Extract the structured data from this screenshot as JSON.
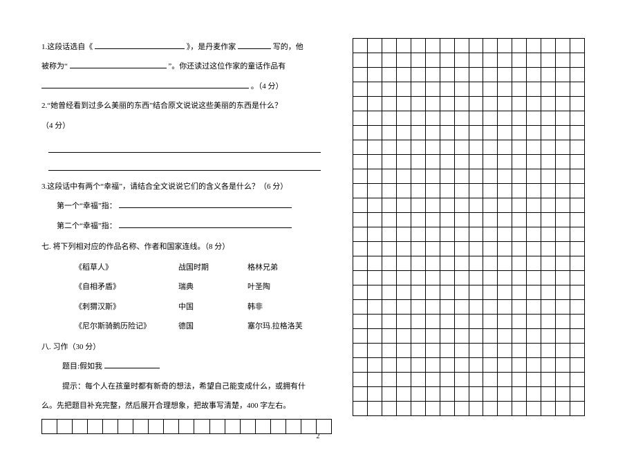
{
  "q1": {
    "prefix": "1.这段话选自《",
    "mid1": "》，是丹麦作家",
    "mid2": "写的，他",
    "line2a": "被称为“",
    "line2b": "”。你还读过这位作家的童话作品有",
    "points": "。（4 分）"
  },
  "q2": {
    "text": "2.“她曾经看到过多么美丽的东西”结合原文说说这些美丽的东西是什么？",
    "points": "（4 分）"
  },
  "q3": {
    "text": "3.这段话中有两个“幸福”，请结合全文说说它们的含义各是什么？（6 分）",
    "first": "第一个“幸福”指：",
    "second": "第二个“幸福”指："
  },
  "q7": {
    "heading": "七. 将下列相对应的作品名称、作者和国家连线。（8 分）",
    "rows": [
      {
        "work": "《稻草人》",
        "col2": "战国时期",
        "col3": "格林兄弟"
      },
      {
        "work": "《自相矛盾》",
        "col2": "瑞典",
        "col3": "叶圣陶"
      },
      {
        "work": "《刺猬汉斯》",
        "col2": "中国",
        "col3": "韩非"
      },
      {
        "work": "《尼尔斯骑鹅历险记》",
        "col2": "德国",
        "col3": "塞尔玛.拉格洛芙"
      }
    ]
  },
  "q8": {
    "heading": "八. 习作（30 分）",
    "topic": "题目:假如我",
    "hint1": "提示：每个人在孩童时都有新奇的想法，希望自己能变成什么，或拥有什",
    "hint2": "么。先把题目补充完整，然后展开合理想象，把故事写清楚，400 字左右。"
  },
  "pagenum": "2",
  "gridLeftCols": 19,
  "gridRightCols": 16,
  "gridRightRows": 26
}
